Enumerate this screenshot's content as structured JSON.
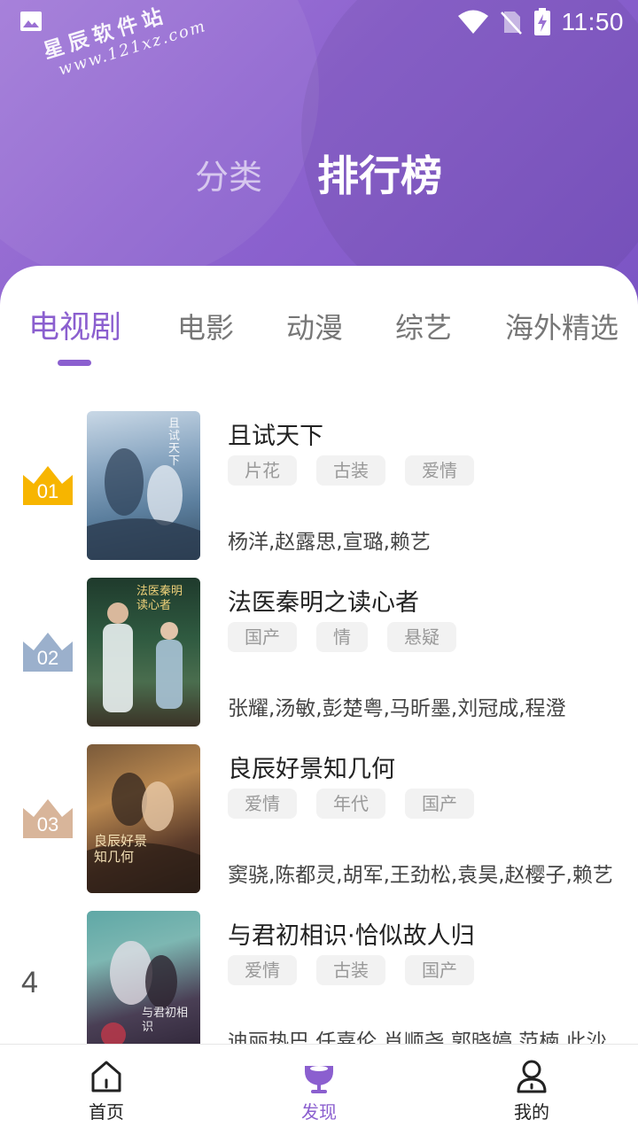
{
  "status_bar": {
    "time": "11:50",
    "icons": [
      "image-icon",
      "wifi-icon",
      "no-sim-icon",
      "battery-charging-icon"
    ]
  },
  "watermark": {
    "line1": "星辰软件站",
    "line2": "www.121xz.com"
  },
  "top_tabs": [
    {
      "label": "分类",
      "active": false
    },
    {
      "label": "排行榜",
      "active": true
    }
  ],
  "category_tabs": [
    {
      "label": "电视剧",
      "active": true
    },
    {
      "label": "电影",
      "active": false
    },
    {
      "label": "动漫",
      "active": false
    },
    {
      "label": "综艺",
      "active": false
    },
    {
      "label": "海外精选",
      "active": false
    }
  ],
  "ranking": [
    {
      "rank": "01",
      "title": "且试天下",
      "tags": [
        "片花",
        "古装",
        "爱情"
      ],
      "cast": "杨洋,赵露思,宣璐,赖艺",
      "poster_text": "且试天下"
    },
    {
      "rank": "02",
      "title": "法医秦明之读心者",
      "tags": [
        "国产",
        "情",
        "悬疑"
      ],
      "cast": "张耀,汤敏,彭楚粤,马昕墨,刘冠成,程澄",
      "poster_text": "法医秦明 读心者"
    },
    {
      "rank": "03",
      "title": "良辰好景知几何",
      "tags": [
        "爱情",
        "年代",
        "国产"
      ],
      "cast": "窦骁,陈都灵,胡军,王劲松,袁昊,赵樱子,赖艺",
      "poster_text": "良辰好景知几何"
    },
    {
      "rank": "4",
      "title": "与君初相识·恰似故人归",
      "tags": [
        "爱情",
        "古装",
        "国产"
      ],
      "cast": "迪丽热巴,任嘉伦,肖顺尧,郭晓婷,范楠,此沙",
      "poster_text": "与君初相识"
    }
  ],
  "bottom_nav": [
    {
      "label": "首页",
      "icon": "home-icon",
      "active": false
    },
    {
      "label": "发现",
      "icon": "trophy-icon",
      "active": true
    },
    {
      "label": "我的",
      "icon": "user-icon",
      "active": false
    }
  ],
  "colors": {
    "accent": "#8b5fcf",
    "gold": "#f7b500",
    "silver": "#9bb0cc",
    "bronze": "#d8b59a"
  }
}
